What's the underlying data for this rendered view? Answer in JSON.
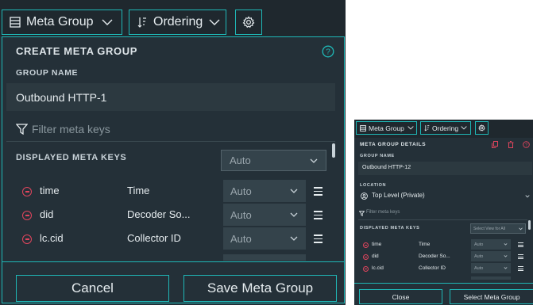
{
  "main": {
    "toolbar": {
      "meta_group": "Meta Group",
      "ordering": "Ordering"
    },
    "title": "CREATE META GROUP",
    "group_name_label": "GROUP NAME",
    "group_name_value": "Outbound HTTP-1",
    "filter_placeholder": "Filter meta keys",
    "displayed_label": "DISPLAYED META KEYS",
    "displayed_select": "Auto",
    "rows": [
      {
        "key": "time",
        "name": "Time",
        "view": "Auto"
      },
      {
        "key": "did",
        "name": "Decoder So...",
        "view": "Auto"
      },
      {
        "key": "lc.cid",
        "name": "Collector ID",
        "view": "Auto"
      }
    ],
    "cancel": "Cancel",
    "save": "Save Meta Group"
  },
  "detail": {
    "toolbar": {
      "meta_group": "Meta Group",
      "ordering": "Ordering"
    },
    "title": "META GROUP DETAILS",
    "group_name_label": "GROUP NAME",
    "group_name_value": "Outbound HTTP-12",
    "location_label": "LOCATION",
    "location_value": "Top Level (Private)",
    "filter_placeholder": "Filter meta keys",
    "displayed_label": "DISPLAYED META KEYS",
    "view_select": "Select View for All",
    "rows": [
      {
        "key": "time",
        "name": "Time",
        "view": "Auto"
      },
      {
        "key": "did",
        "name": "Decoder So...",
        "view": "Auto"
      },
      {
        "key": "lc.cid",
        "name": "Collector ID",
        "view": "Auto"
      }
    ],
    "close": "Close",
    "select_group": "Select Meta Group"
  },
  "colors": {
    "accent": "#1fb8b7",
    "panel": "#243038",
    "remove": "#e0455d"
  }
}
